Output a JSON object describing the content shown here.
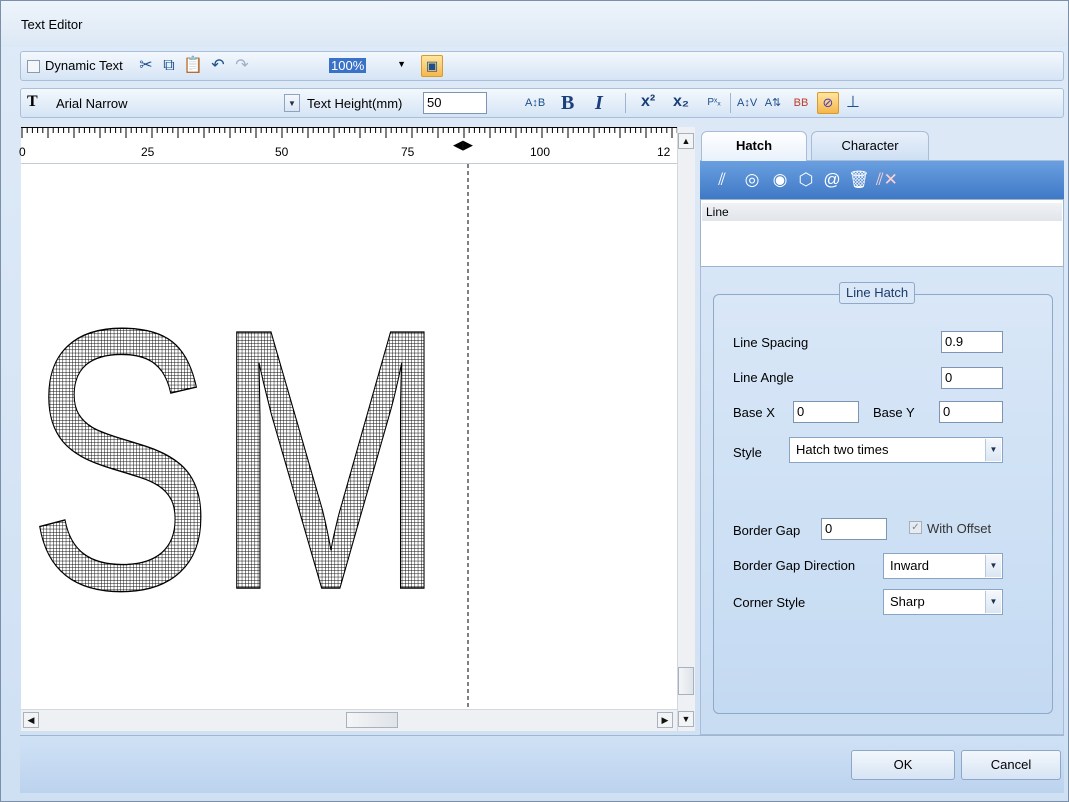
{
  "window": {
    "title": "Text Editor"
  },
  "toolbar1": {
    "dynamic_text_label": "Dynamic Text",
    "dynamic_text_checked": false,
    "zoom_value": "100%"
  },
  "toolbar2": {
    "font_icon": "T",
    "font_name": "Arial Narrow",
    "text_height_label": "Text Height(mm)",
    "text_height_value": "50",
    "bold_label": "B",
    "italic_label": "I"
  },
  "ruler": {
    "labels": [
      "0",
      "25",
      "50",
      "75",
      "100",
      "12"
    ]
  },
  "canvas": {
    "text": "SM"
  },
  "tabs": {
    "hatch": "Hatch",
    "character": "Character"
  },
  "hatch_list": {
    "items": [
      "Line"
    ]
  },
  "line_hatch": {
    "group_title": "Line Hatch",
    "line_spacing_label": "Line Spacing",
    "line_spacing_value": "0.9",
    "line_angle_label": "Line Angle",
    "line_angle_value": "0",
    "base_x_label": "Base X",
    "base_x_value": "0",
    "base_y_label": "Base Y",
    "base_y_value": "0",
    "style_label": "Style",
    "style_value": "Hatch two times",
    "border_gap_label": "Border Gap",
    "border_gap_value": "0",
    "with_offset_label": "With Offset",
    "with_offset_checked": true,
    "border_gap_direction_label": "Border Gap Direction",
    "border_gap_direction_value": "Inward",
    "corner_style_label": "Corner Style",
    "corner_style_value": "Sharp"
  },
  "buttons": {
    "ok": "OK",
    "cancel": "Cancel"
  },
  "colors": {
    "accent": "#3f78c6",
    "hatch_bar": "#5a8fd8",
    "window_bg": "#dce8f5"
  }
}
